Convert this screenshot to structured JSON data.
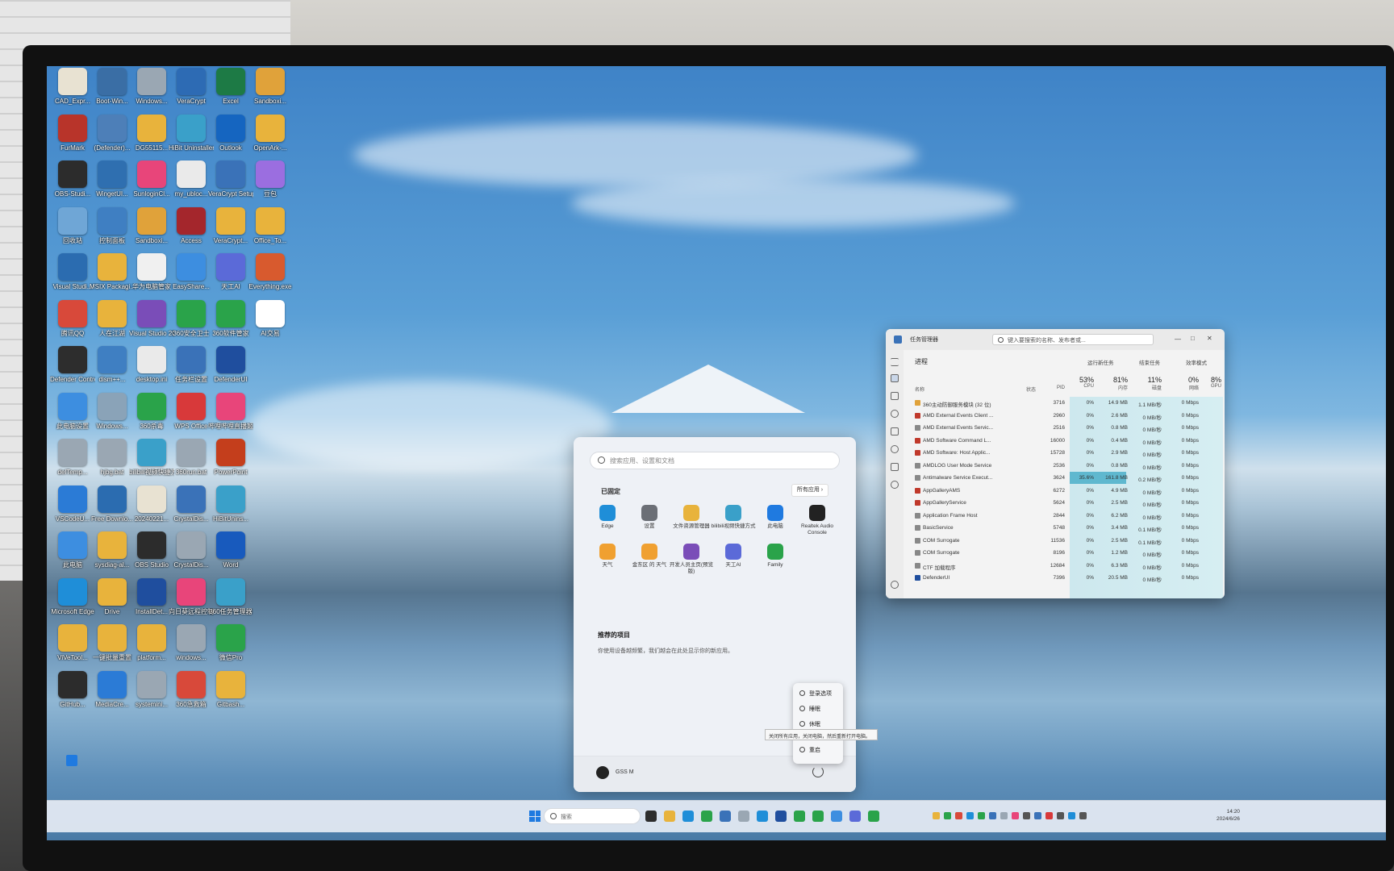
{
  "desktop": {
    "icons": [
      {
        "label": "CAD_Expr...",
        "color": "#e8e2d2"
      },
      {
        "label": "Boot-Win...",
        "color": "#3a6ea5"
      },
      {
        "label": "Windows...",
        "color": "#9aa7b3"
      },
      {
        "label": "VeraCrypt",
        "color": "#2d6bb4"
      },
      {
        "label": "Excel",
        "color": "#1d7a45"
      },
      {
        "label": "Sandboxi...",
        "color": "#e0a23a"
      },
      {
        "label": "FurMark",
        "color": "#b8342a"
      },
      {
        "label": "(Defender)...",
        "color": "#4d7fb8"
      },
      {
        "label": "DG55115...",
        "color": "#e8b33c"
      },
      {
        "label": "HiBit Uninstaller",
        "color": "#3aa0c9"
      },
      {
        "label": "Outlook",
        "color": "#1565c0"
      },
      {
        "label": "OpenArk-...",
        "color": "#e8b33c"
      },
      {
        "label": "OBS-Studi...",
        "color": "#2c2c2c"
      },
      {
        "label": "WingetUI...",
        "color": "#2f6fb0"
      },
      {
        "label": "SunloginCl...",
        "color": "#e8457a"
      },
      {
        "label": "my_ubloc...",
        "color": "#eaeaea"
      },
      {
        "label": "VeraCrypt Setup 1....",
        "color": "#3a72b8"
      },
      {
        "label": "豆包",
        "color": "#9b6ee0"
      },
      {
        "label": "回收站",
        "color": "#6fa6d6"
      },
      {
        "label": "控制面板",
        "color": "#3f7fc2"
      },
      {
        "label": "Sandboxi...",
        "color": "#e0a23a"
      },
      {
        "label": "Access",
        "color": "#a4262c"
      },
      {
        "label": "VeraCrypt...",
        "color": "#e8b33c"
      },
      {
        "label": "Office_To...",
        "color": "#e8b33c"
      },
      {
        "label": "Visual Studi...",
        "color": "#2b6cb0"
      },
      {
        "label": "MSIX Packagi...",
        "color": "#e8b33c"
      },
      {
        "label": "华为电脑管家",
        "color": "#f0f0f0"
      },
      {
        "label": "EasyShare...",
        "color": "#3d8ee0"
      },
      {
        "label": "天工AI",
        "color": "#5b6ad8"
      },
      {
        "label": "Everything.exe",
        "color": "#d85a2e"
      },
      {
        "label": "腾讯QQ",
        "color": "#d8493a"
      },
      {
        "label": "人在江湖",
        "color": "#e8b33c"
      },
      {
        "label": "Visual Studio 2022",
        "color": "#7a4db8"
      },
      {
        "label": "360安全卫士",
        "color": "#2aa34a"
      },
      {
        "label": "360软件管家",
        "color": "#2aa34a"
      },
      {
        "label": "AI交易",
        "color": "#ffffff"
      },
      {
        "label": "Defender Control",
        "color": "#2d2d2d"
      },
      {
        "label": "dism++...",
        "color": "#3f7fc2"
      },
      {
        "label": "desktop.ini",
        "color": "#eaeaea"
      },
      {
        "label": "任务栏设置",
        "color": "#3a72b8"
      },
      {
        "label": "DefenderUI",
        "color": "#1f4e9e"
      },
      {
        "label": "此电脑设置",
        "color": "#3d8ee0"
      },
      {
        "label": "Windows...",
        "color": "#8aa3b8"
      },
      {
        "label": "360杀毒",
        "color": "#2aa34a"
      },
      {
        "label": "WPS Office",
        "color": "#d8393a"
      },
      {
        "label": "哔哩哔哩直播姬",
        "color": "#e8457a"
      },
      {
        "label": "delTemp...",
        "color": "#9aa7b3"
      },
      {
        "label": "hjbg.bat",
        "color": "#9aa7b3"
      },
      {
        "label": "bilibili视频快捷方式",
        "color": "#3aa0c9"
      },
      {
        "label": "360run.bat",
        "color": "#9aa7b3"
      },
      {
        "label": "PowerPoint",
        "color": "#c43e1c"
      },
      {
        "label": "VSCodeU...",
        "color": "#2b7bd6"
      },
      {
        "label": "Free Downlo...",
        "color": "#2b6cb0"
      },
      {
        "label": "20240221...",
        "color": "#e8e2d2"
      },
      {
        "label": "CrystalDis...",
        "color": "#3a72b8"
      },
      {
        "label": "HiBitUnins...",
        "color": "#3aa0c9"
      },
      {
        "label": "此电脑",
        "color": "#3d8ee0"
      },
      {
        "label": "sysdiag-al...",
        "color": "#e8b33c"
      },
      {
        "label": "OBS Studio",
        "color": "#2c2c2c"
      },
      {
        "label": "CrystalDis...",
        "color": "#9aa7b3"
      },
      {
        "label": "Word",
        "color": "#185abd"
      },
      {
        "label": "Microsoft Edge",
        "color": "#1f8ed8"
      },
      {
        "label": "Drive",
        "color": "#e8b33c"
      },
      {
        "label": "InstallDet...",
        "color": "#1f4e9e"
      },
      {
        "label": "向日葵远程控制",
        "color": "#e8457a"
      },
      {
        "label": "360任务管理器",
        "color": "#3aa0c9"
      },
      {
        "label": "ViVeTool...",
        "color": "#e8b33c"
      },
      {
        "label": "一键批量重置",
        "color": "#e8b33c"
      },
      {
        "label": "platform...",
        "color": "#e8b33c"
      },
      {
        "label": "windows...",
        "color": "#9aa7b3"
      },
      {
        "label": "微信Pro",
        "color": "#2aa34a"
      },
      {
        "label": "GitHub...",
        "color": "#2c2c2c"
      },
      {
        "label": "MediaCre...",
        "color": "#2b7bd6"
      },
      {
        "label": "systemini...",
        "color": "#9aa7b3"
      },
      {
        "label": "360急救箱",
        "color": "#d8493a"
      },
      {
        "label": "Gitbash...",
        "color": "#e8b33c"
      }
    ]
  },
  "start_menu": {
    "search_placeholder": "搜索应用、设置和文档",
    "pinned_header": "已固定",
    "all_apps_label": "所有应用 ›",
    "pinned": [
      {
        "label": "Edge",
        "color": "#1f8ed8"
      },
      {
        "label": "设置",
        "color": "#6b6f76"
      },
      {
        "label": "文件资源管理器",
        "color": "#e8b33c"
      },
      {
        "label": "bilibili视频快捷方式",
        "color": "#3aa0c9"
      },
      {
        "label": "此电脑",
        "color": "#1f7ae0"
      },
      {
        "label": "Realtek Audio Console",
        "color": "#222222"
      },
      {
        "label": "天气",
        "color": "#f0a030"
      },
      {
        "label": "金东区 的 天气",
        "color": "#f0a030"
      },
      {
        "label": "开发人员主页(预览版)",
        "color": "#7a4db8"
      },
      {
        "label": "天工AI",
        "color": "#5b6ad8"
      },
      {
        "label": "Family",
        "color": "#2aa34a"
      }
    ],
    "recommended_header": "推荐的项目",
    "recommended_text": "你使用设备越频繁，我们越会在此处显示你的新应用。",
    "user_name": "GSS M",
    "power_menu": [
      {
        "label": "登录选项"
      },
      {
        "label": "睡眠"
      },
      {
        "label": "休眠"
      },
      {
        "label": "重启"
      }
    ],
    "tooltip": "关闭所有应用，关闭电脑，然后重新打开电脑。"
  },
  "task_manager": {
    "title": "任务管理器",
    "search_placeholder": "键入要搜索的名称、发布者或...",
    "tab": "进程",
    "actions": [
      "运行新任务",
      "结束任务",
      "效率模式"
    ],
    "columns": [
      {
        "name": "名称"
      },
      {
        "name": "状态"
      },
      {
        "name": "PID"
      },
      {
        "name": "CPU",
        "pct": "53%"
      },
      {
        "name": "内存",
        "pct": "81%"
      },
      {
        "name": "磁盘",
        "pct": "11%"
      },
      {
        "name": "网络",
        "pct": "0%"
      },
      {
        "name": "GPU",
        "pct": "8%"
      }
    ],
    "rows": [
      {
        "name": "360主动防御服务模块 (32 位)",
        "pid": "3716",
        "cpu": "0%",
        "mem": "14.9 MB",
        "disk": "1.1 MB/秒",
        "net": "0 Mbps",
        "color": "#e0a23a"
      },
      {
        "name": "AMD External Events Client ...",
        "pid": "2960",
        "cpu": "0%",
        "mem": "2.6 MB",
        "disk": "0 MB/秒",
        "net": "0 Mbps",
        "color": "#c0392b"
      },
      {
        "name": "AMD External Events Servic...",
        "pid": "2516",
        "cpu": "0%",
        "mem": "0.8 MB",
        "disk": "0 MB/秒",
        "net": "0 Mbps",
        "color": "#888888"
      },
      {
        "name": "AMD Software Command L...",
        "pid": "16000",
        "cpu": "0%",
        "mem": "0.4 MB",
        "disk": "0 MB/秒",
        "net": "0 Mbps",
        "color": "#c0392b"
      },
      {
        "name": "AMD Software: Host Applic...",
        "pid": "15728",
        "cpu": "0%",
        "mem": "2.9 MB",
        "disk": "0 MB/秒",
        "net": "0 Mbps",
        "color": "#c0392b"
      },
      {
        "name": "AMDLOG User Mode Service",
        "pid": "2536",
        "cpu": "0%",
        "mem": "0.8 MB",
        "disk": "0 MB/秒",
        "net": "0 Mbps",
        "color": "#888888"
      },
      {
        "name": "Antimalware Service Execut...",
        "pid": "3624",
        "cpu": "35.6%",
        "mem": "161.8 MB",
        "disk": "0.2 MB/秒",
        "net": "0 Mbps",
        "color": "#888888"
      },
      {
        "name": "AppGalleryAMS",
        "pid": "6272",
        "cpu": "0%",
        "mem": "4.9 MB",
        "disk": "0 MB/秒",
        "net": "0 Mbps",
        "color": "#c0392b"
      },
      {
        "name": "AppGalleryService",
        "pid": "5624",
        "cpu": "0%",
        "mem": "2.5 MB",
        "disk": "0 MB/秒",
        "net": "0 Mbps",
        "color": "#c0392b"
      },
      {
        "name": "Application Frame Host",
        "pid": "2844",
        "cpu": "0%",
        "mem": "6.2 MB",
        "disk": "0 MB/秒",
        "net": "0 Mbps",
        "color": "#888888"
      },
      {
        "name": "BasicService",
        "pid": "5748",
        "cpu": "0%",
        "mem": "3.4 MB",
        "disk": "0.1 MB/秒",
        "net": "0 Mbps",
        "color": "#888888"
      },
      {
        "name": "COM Surrogate",
        "pid": "11536",
        "cpu": "0%",
        "mem": "2.5 MB",
        "disk": "0.1 MB/秒",
        "net": "0 Mbps",
        "color": "#888888"
      },
      {
        "name": "COM Surrogate",
        "pid": "8196",
        "cpu": "0%",
        "mem": "1.2 MB",
        "disk": "0 MB/秒",
        "net": "0 Mbps",
        "color": "#888888"
      },
      {
        "name": "CTF 加载程序",
        "pid": "12684",
        "cpu": "0%",
        "mem": "6.3 MB",
        "disk": "0 MB/秒",
        "net": "0 Mbps",
        "color": "#888888"
      },
      {
        "name": "DefenderUI",
        "pid": "7396",
        "cpu": "0%",
        "mem": "20.5 MB",
        "disk": "0 MB/秒",
        "net": "0 Mbps",
        "color": "#1f4e9e"
      }
    ]
  },
  "taskbar": {
    "search_placeholder": "搜索",
    "apps": [
      "#2d2d2d",
      "#e8b33c",
      "#1f8ed8",
      "#2aa34a",
      "#3a72b8",
      "#9aa7b3",
      "#1f8ed8",
      "#1f4e9e",
      "#2aa34a",
      "#2aa34a",
      "#3d8ee0",
      "#5b6ad8",
      "#2aa34a"
    ],
    "tray": [
      "#e8b33c",
      "#2aa34a",
      "#d8493a",
      "#1f8ed8",
      "#2aa34a",
      "#3a72b8",
      "#9aa7b3",
      "#e8457a",
      "#555555",
      "#3a72b8",
      "#d8393a",
      "#555555",
      "#1f8ed8",
      "#555555"
    ],
    "time": "14:20",
    "date": "2024/6/26"
  }
}
